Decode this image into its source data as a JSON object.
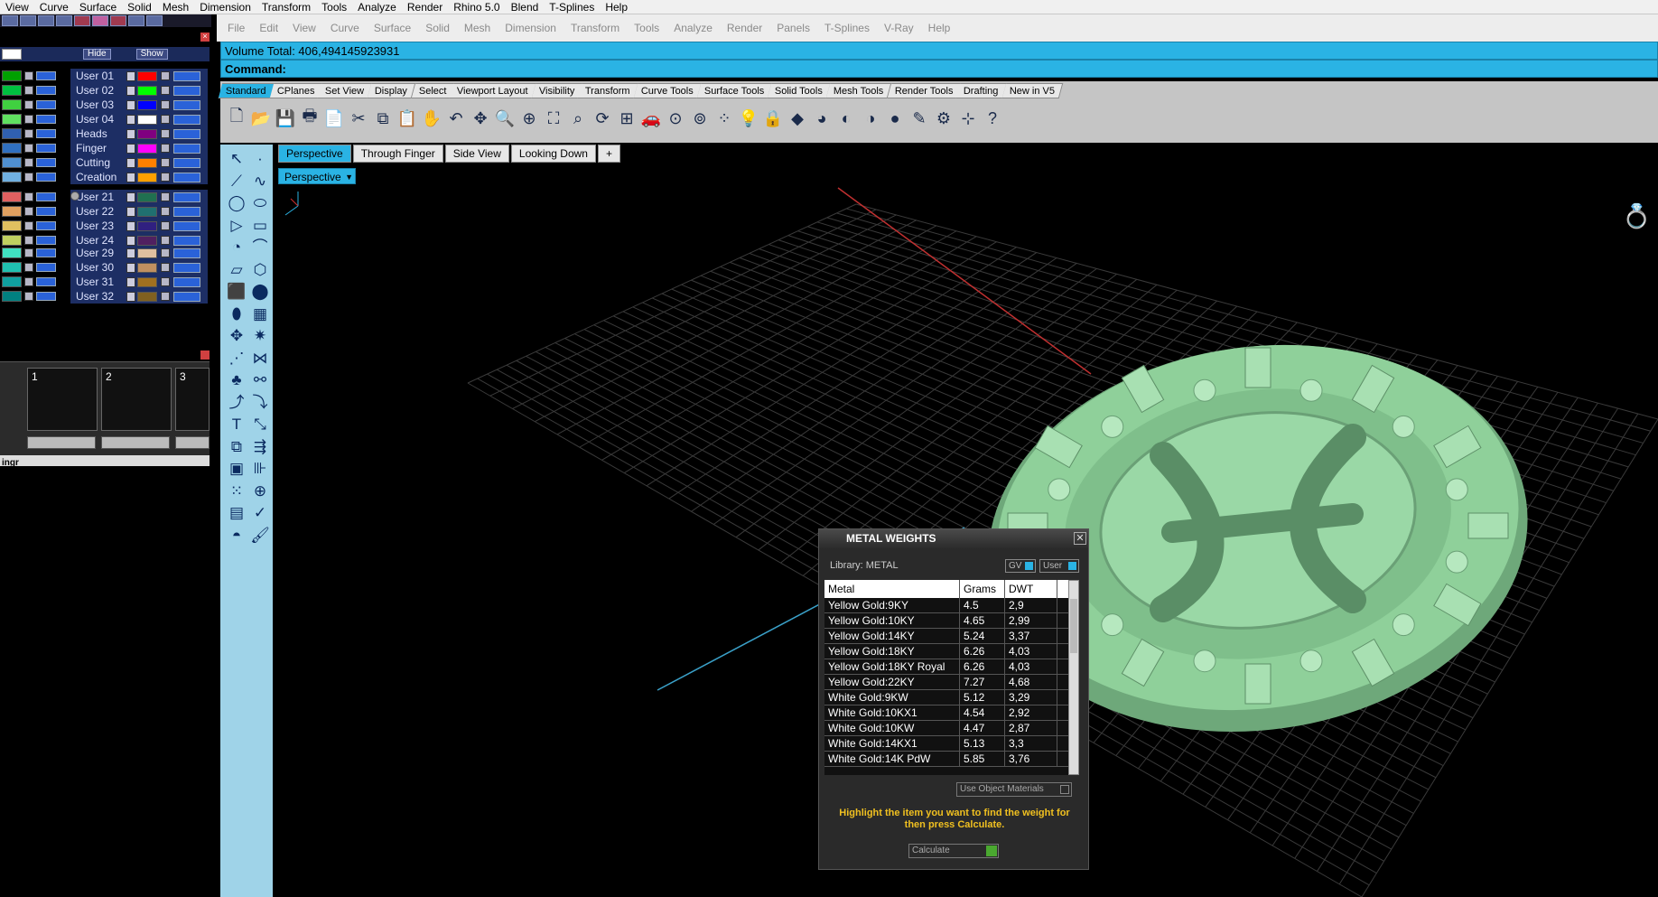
{
  "outer_menu": [
    "View",
    "Curve",
    "Surface",
    "Solid",
    "Mesh",
    "Dimension",
    "Transform",
    "Tools",
    "Analyze",
    "Render",
    "Rhino 5.0",
    "Blend",
    "T-Splines",
    "Help"
  ],
  "rhino_menu": [
    "File",
    "Edit",
    "View",
    "Curve",
    "Surface",
    "Solid",
    "Mesh",
    "Dimension",
    "Transform",
    "Tools",
    "Analyze",
    "Render",
    "Panels",
    "T-Splines",
    "V-Ray",
    "Help"
  ],
  "command_history": "Volume Total: 406,494145923931",
  "command_label": "Command:",
  "toolbar_tabs": [
    "Standard",
    "CPlanes",
    "Set View",
    "Display",
    "Select",
    "Viewport Layout",
    "Visibility",
    "Transform",
    "Curve Tools",
    "Surface Tools",
    "Solid Tools",
    "Mesh Tools",
    "Render Tools",
    "Drafting",
    "New in V5"
  ],
  "viewport_tabs": [
    "Perspective",
    "Through Finger",
    "Side View",
    "Looking Down"
  ],
  "viewport_add": "+",
  "viewport_label": "Perspective",
  "layer_panel": {
    "hide_label": "Hide",
    "show_label": "Show",
    "groups": [
      [
        {
          "name": "User 01",
          "color": "#00a000",
          "color2": "#ff0000"
        },
        {
          "name": "User 02",
          "color": "#00c040",
          "color2": "#00ff00"
        },
        {
          "name": "User 03",
          "color": "#40d040",
          "color2": "#0000ff"
        },
        {
          "name": "User 04",
          "color": "#60e060",
          "color2": "#ffffff"
        }
      ],
      [
        {
          "name": "Heads",
          "color": "#3060b0",
          "color2": "#800080"
        },
        {
          "name": "Finger",
          "color": "#3070c0",
          "color2": "#ff00ff"
        },
        {
          "name": "Cutting",
          "color": "#5090d0",
          "color2": "#ff8000"
        },
        {
          "name": "Creation",
          "color": "#70b0e0",
          "color2": "#ffa000"
        }
      ],
      [
        {
          "name": "User 21",
          "color": "#e06060",
          "color2": "#207050"
        },
        {
          "name": "User 22",
          "color": "#e0a060",
          "color2": "#207070"
        },
        {
          "name": "User 23",
          "color": "#e0c060",
          "color2": "#302080"
        },
        {
          "name": "User 24",
          "color": "#c0d060",
          "color2": "#502060"
        }
      ],
      [
        {
          "name": "User 29",
          "color": "#40e0c0",
          "color2": "#e0c0a0"
        },
        {
          "name": "User 30",
          "color": "#20c0b0",
          "color2": "#c09060"
        },
        {
          "name": "User 31",
          "color": "#10a0a0",
          "color2": "#a07020"
        },
        {
          "name": "User 32",
          "color": "#008080",
          "color2": "#806020"
        }
      ]
    ],
    "blocks": [
      "1",
      "2",
      "3"
    ],
    "bottom_label": "ingr"
  },
  "metal_weights": {
    "title": "METAL WEIGHTS",
    "library": "Library: METAL",
    "gv_label": "GV",
    "user_label": "User",
    "columns": [
      "Metal",
      "Grams",
      "DWT"
    ],
    "rows": [
      [
        "Yellow Gold:9KY",
        "4.5",
        "2,9"
      ],
      [
        "Yellow Gold:10KY",
        "4.65",
        "2,99"
      ],
      [
        "Yellow Gold:14KY",
        "5.24",
        "3,37"
      ],
      [
        "Yellow Gold:18KY",
        "6.26",
        "4,03"
      ],
      [
        "Yellow Gold:18KY Royal",
        "6.26",
        "4,03"
      ],
      [
        "Yellow Gold:22KY",
        "7.27",
        "4,68"
      ],
      [
        "White Gold:9KW",
        "5.12",
        "3,29"
      ],
      [
        "White Gold:10KX1",
        "4.54",
        "2,92"
      ],
      [
        "White Gold:10KW",
        "4.47",
        "2,87"
      ],
      [
        "White Gold:14KX1",
        "5.13",
        "3,3"
      ],
      [
        "White Gold:14K PdW",
        "5.85",
        "3,76"
      ]
    ],
    "use_object_materials": "Use Object Materials",
    "hint": "Highlight the item you want to find the weight for then press Calculate.",
    "calculate": "Calculate"
  },
  "colors": {
    "accent": "#2ab3e4",
    "model": "#8fd09a",
    "grid": "#3a3a3a"
  }
}
